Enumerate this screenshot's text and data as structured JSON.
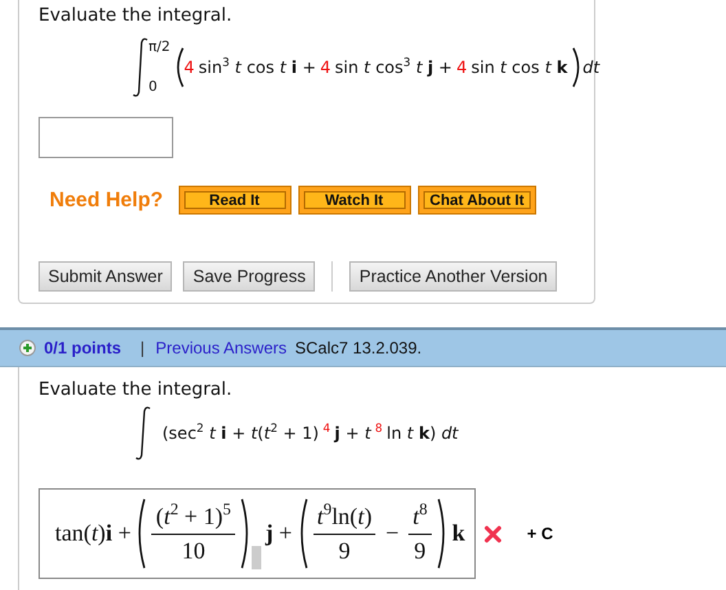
{
  "question1": {
    "prompt": "Evaluate the integral.",
    "integral": {
      "upper": "π/2",
      "lower": "0",
      "segments": [
        {
          "text": "4",
          "highlighted": true
        },
        {
          "text": "sin$^{3}$ *t* cos *t* **i** +",
          "highlighted": false
        },
        {
          "text": "4",
          "highlighted": true
        },
        {
          "text": "sin *t* cos$^{3}$ *t* **j** +",
          "highlighted": false
        },
        {
          "text": "4",
          "highlighted": true
        },
        {
          "text": "sin *t* cos *t* **k**",
          "highlighted": false
        }
      ],
      "differential": "*dt*"
    },
    "help": {
      "label": "Need Help?",
      "buttons": [
        "Read It",
        "Watch It",
        "Chat About It"
      ]
    },
    "actions": [
      {
        "label": "Submit Answer",
        "divider_before": false
      },
      {
        "label": "Save Progress",
        "divider_before": false
      },
      {
        "label": "Practice Another Version",
        "divider_before": true
      }
    ]
  },
  "question2": {
    "header": {
      "points": "0/1 points",
      "separator": "|",
      "link": "Previous Answers",
      "source": "SCalc7 13.2.039."
    },
    "prompt": "Evaluate the integral.",
    "integral": {
      "segments": [
        {
          "text": "(sec$^{2}$ *t* **i** + *t*(*t*$^{2}$ + 1)",
          "highlighted": false
        },
        {
          "text": "$^{4}$",
          "highlighted": true
        },
        {
          "text": "**j** + *t*",
          "highlighted": false
        },
        {
          "text": "$^{8}$",
          "highlighted": true
        },
        {
          "text": "ln *t* **k**) *dt*",
          "highlighted": false
        }
      ]
    },
    "answer": {
      "correct": false,
      "constant": "+ C",
      "parts": [
        {
          "kind": "text",
          "text": "tan(*t*)**i** +"
        },
        {
          "kind": "group",
          "children": [
            {
              "kind": "frac",
              "num": "(*t*$^{2}$ + 1)$^{5}$",
              "den": "10"
            }
          ]
        },
        {
          "kind": "cursor"
        },
        {
          "kind": "text",
          "text": "**j** +"
        },
        {
          "kind": "group",
          "children": [
            {
              "kind": "frac",
              "num": "*t*$^{9}$ln(*t*)",
              "den": "9"
            },
            {
              "kind": "text",
              "text": "−"
            },
            {
              "kind": "frac",
              "num": "*t*$^{8}$",
              "den": "9"
            }
          ]
        },
        {
          "kind": "text",
          "text": "**k**"
        }
      ]
    }
  }
}
